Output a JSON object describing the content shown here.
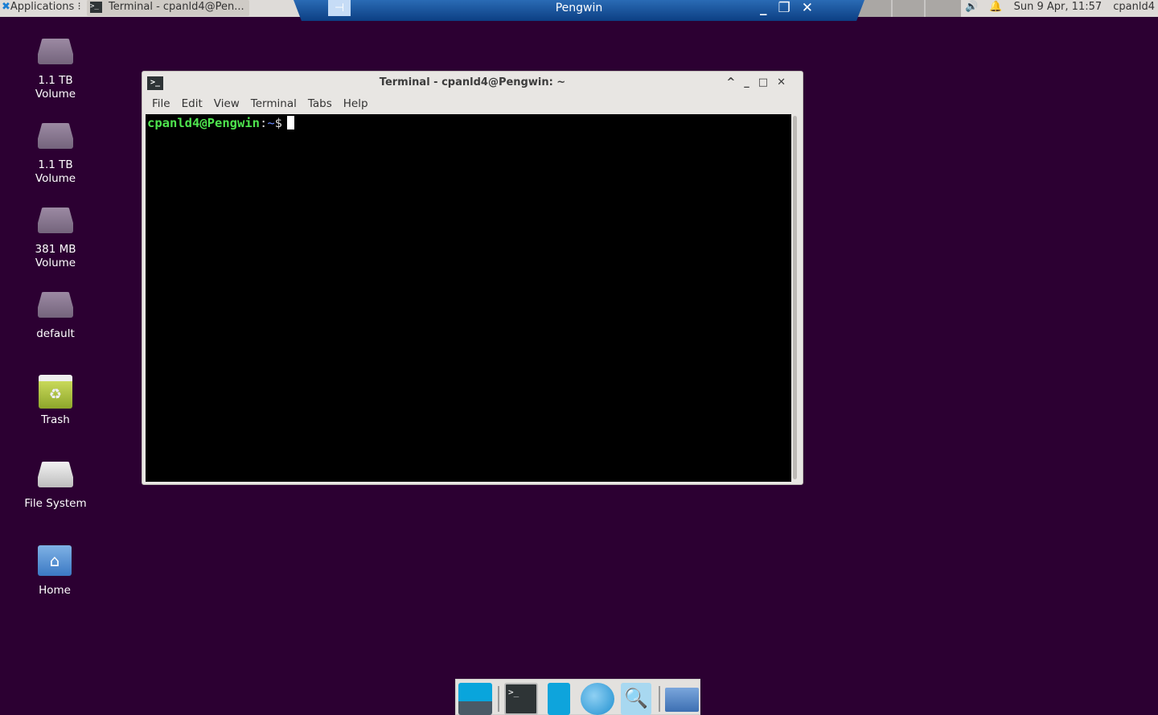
{
  "top_panel": {
    "applications_label": "Applications",
    "task_button_label": "Terminal - cpanld4@Pen...",
    "tray": {
      "volume_icon": "speaker-icon",
      "notification_icon": "bell-icon",
      "clock": "Sun  9 Apr, 11:57",
      "user": "cpanld4"
    }
  },
  "remote_bar": {
    "title": "Pengwin",
    "controls": [
      "minimize",
      "restore",
      "close"
    ]
  },
  "desktop_icons": [
    {
      "label": "1.1 TB\nVolume",
      "line1": "1.1 TB",
      "line2": "Volume",
      "icon": "drive-icon"
    },
    {
      "label": "1.1 TB\nVolume",
      "line1": "1.1 TB",
      "line2": "Volume",
      "icon": "drive-icon"
    },
    {
      "label": "381 MB\nVolume",
      "line1": "381 MB",
      "line2": "Volume",
      "icon": "drive-icon"
    },
    {
      "line1": "default",
      "icon": "drive-icon"
    },
    {
      "line1": "Trash",
      "icon": "trash-icon"
    },
    {
      "line1": "File System",
      "icon": "drive-icon"
    },
    {
      "line1": "Home",
      "icon": "home-folder-icon"
    }
  ],
  "terminal_window": {
    "title": "Terminal - cpanld4@Pengwin: ~",
    "menu": [
      "File",
      "Edit",
      "View",
      "Terminal",
      "Tabs",
      "Help"
    ],
    "prompt_user": "cpanld4@Pengwin",
    "prompt_colon": ":",
    "prompt_path": "~",
    "prompt_symbol": "$"
  },
  "dock": [
    "show-desktop",
    "terminal",
    "file-manager",
    "web-browser",
    "app-finder",
    "folder"
  ],
  "colors": {
    "desktop": "#2c0032",
    "prompt_green": "#4ee44e",
    "rdp_bar": "#0c3f83"
  }
}
